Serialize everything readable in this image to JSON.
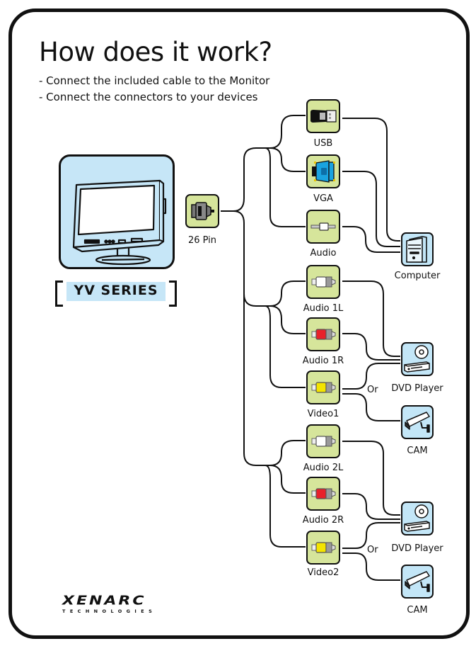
{
  "heading": {
    "title": "How does it work?",
    "steps": [
      "-  Connect the included cable to the Monitor",
      "-  Connect the connectors to your devices"
    ]
  },
  "monitor": {
    "icon": "monitor-icon",
    "series_label": "YV SERIES"
  },
  "source_connector": {
    "label": "26 Pin",
    "icon": "26-pin-connector-icon"
  },
  "connectors": [
    {
      "label": "USB",
      "icon": "usb-plug-icon"
    },
    {
      "label": "VGA",
      "icon": "vga-plug-icon"
    },
    {
      "label": "Audio",
      "icon": "audio-jack-icon"
    },
    {
      "label": "Audio 1L",
      "icon": "rca-white-plug-icon",
      "color": "#ffffff"
    },
    {
      "label": "Audio 1R",
      "icon": "rca-red-plug-icon",
      "color": "#e8212a"
    },
    {
      "label": "Video1",
      "icon": "rca-yellow-plug-icon",
      "color": "#f4e400"
    },
    {
      "label": "Audio 2L",
      "icon": "rca-white-plug-icon",
      "color": "#ffffff"
    },
    {
      "label": "Audio 2R",
      "icon": "rca-red-plug-icon",
      "color": "#e8212a"
    },
    {
      "label": "Video2",
      "icon": "rca-yellow-plug-icon",
      "color": "#f4e400"
    }
  ],
  "devices": [
    {
      "label": "Computer",
      "icon": "computer-tower-icon"
    },
    {
      "label": "DVD Player",
      "icon": "dvd-player-icon"
    },
    {
      "label": "CAM",
      "icon": "security-camera-icon"
    },
    {
      "label": "DVD Player",
      "icon": "dvd-player-icon"
    },
    {
      "label": "CAM",
      "icon": "security-camera-icon"
    }
  ],
  "or_labels": [
    "Or",
    "Or"
  ],
  "connections": [
    {
      "from": "USB",
      "to": "Computer"
    },
    {
      "from": "VGA",
      "to": "Computer"
    },
    {
      "from": "Audio",
      "to": "Computer"
    },
    {
      "from": "Audio 1L",
      "to": "DVD Player"
    },
    {
      "from": "Audio 1R",
      "to": "DVD Player"
    },
    {
      "from": "Video1",
      "to": "DVD Player or CAM"
    },
    {
      "from": "Audio 2L",
      "to": "DVD Player"
    },
    {
      "from": "Audio 2R",
      "to": "DVD Player"
    },
    {
      "from": "Video2",
      "to": "DVD Player or CAM"
    }
  ],
  "brand": {
    "name": "XENARC",
    "tagline": "TECHNOLOGIES"
  },
  "colors": {
    "connector_box": "#d6e59b",
    "device_box": "#c3e6f7",
    "outline": "#111111"
  }
}
